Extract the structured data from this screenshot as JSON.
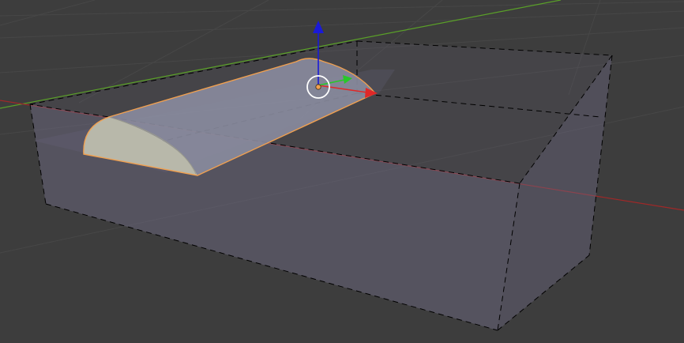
{
  "app": {
    "view": "3d-viewport"
  },
  "viewport": {
    "background_color": "#3d3d3d",
    "grid_color": "#474747",
    "x_axis_color": "#a02828",
    "y_axis_color": "#5aa028",
    "bounding_box_color": "#000000",
    "volume_fill_color": "#6e6a82",
    "selected_outline_color": "#f0a050",
    "object_fill_color": "#8a8c9e",
    "object_cap_color": "#b8b8aa"
  },
  "gizmo": {
    "x_color": "#e02828",
    "y_color": "#28c828",
    "z_color": "#1a1ad8",
    "origin_color": "#f0a050",
    "center_ring_color": "#ffffff"
  }
}
